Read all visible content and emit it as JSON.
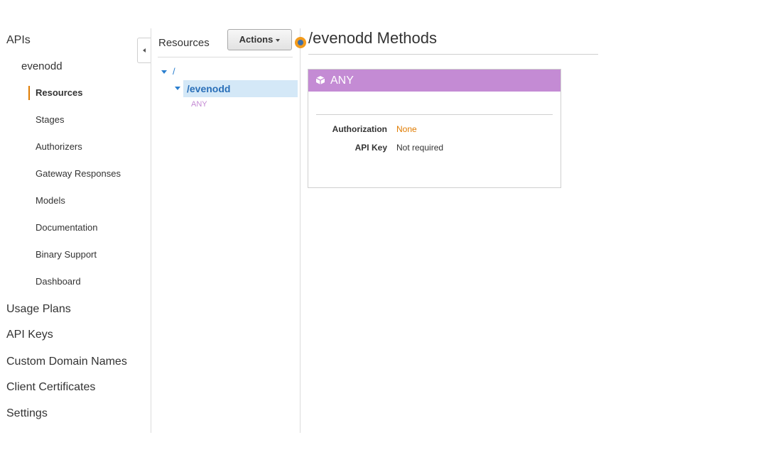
{
  "nav": {
    "apis": "APIs",
    "api_name": "evenodd",
    "sub_items": [
      "Resources",
      "Stages",
      "Authorizers",
      "Gateway Responses",
      "Models",
      "Documentation",
      "Binary Support",
      "Dashboard"
    ],
    "bottom_items": [
      "Usage Plans",
      "API Keys",
      "Custom Domain Names",
      "Client Certificates",
      "Settings"
    ]
  },
  "resources": {
    "title": "Resources",
    "actions_label": "Actions",
    "tree": {
      "root": "/",
      "child": "/evenodd",
      "method": "ANY"
    }
  },
  "main": {
    "title": "/evenodd Methods",
    "method_card": {
      "method": "ANY",
      "authorization_label": "Authorization",
      "authorization_value": "None",
      "api_key_label": "API Key",
      "api_key_value": "Not required"
    }
  },
  "colors": {
    "accent_orange": "#e07b00",
    "method_purple": "#c48bd4",
    "link_blue": "#2a7fcf",
    "selection_blue": "#d4e8f7"
  },
  "icons": {
    "collapse": "chevron-left-icon",
    "method": "cube-icon",
    "tree_expand": "caret-down-icon"
  }
}
